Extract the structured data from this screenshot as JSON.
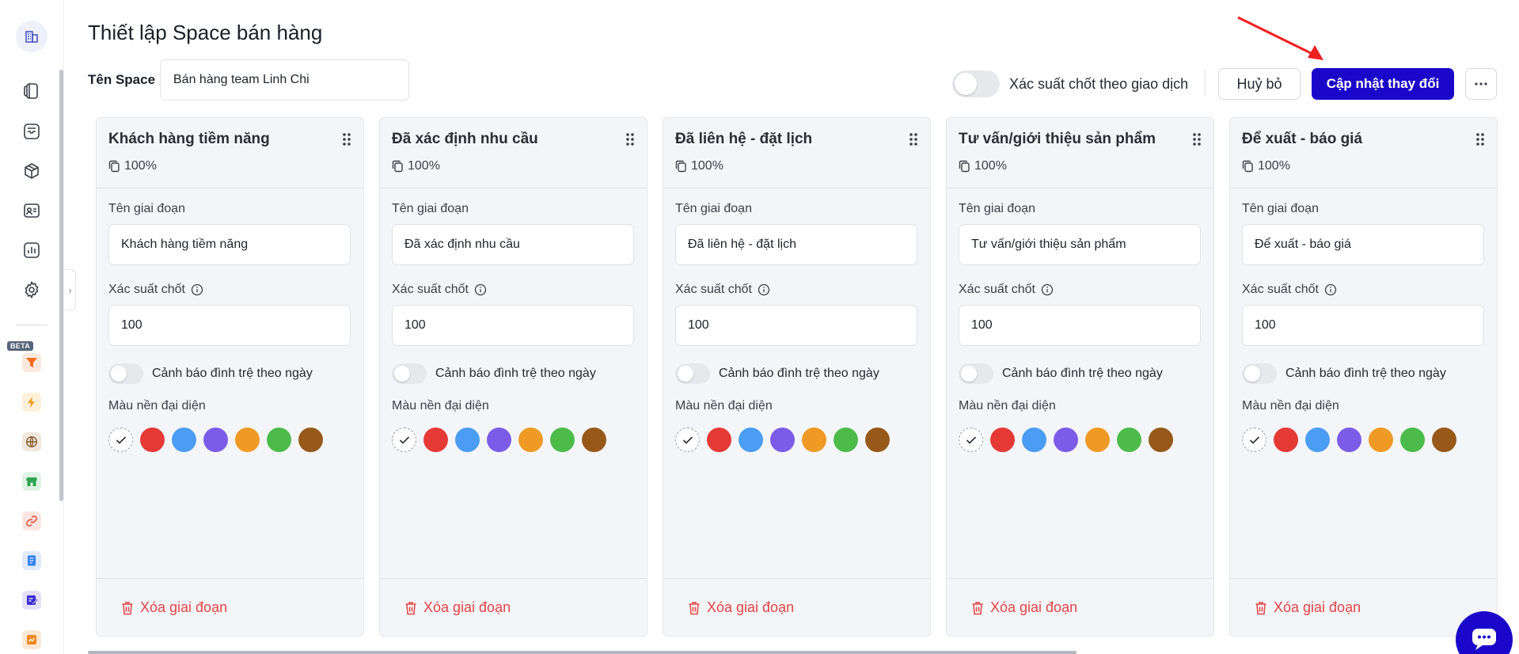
{
  "header": {
    "title": "Thiết lập Space bán hàng",
    "space_label": "Tên Space",
    "space_value": "Bán hàng team Linh Chi",
    "probability_toggle_label": "Xác suất chốt theo giao dịch",
    "cancel_label": "Huỷ bỏ",
    "save_label": "Cập nhật thay đổi",
    "more_label": "···"
  },
  "sidebar": {
    "nav_icons": [
      "book-icon",
      "inbox-icon",
      "box-icon",
      "contact-card-icon",
      "report-chart-icon",
      "settings-gear-icon"
    ],
    "beta_label": "BETA",
    "apps": [
      {
        "icon": "funnel-icon",
        "color": "#f26b1d"
      },
      {
        "icon": "lightning-icon",
        "color": "#f39a1c"
      },
      {
        "icon": "globe-icon",
        "color": "#8a5a2b"
      },
      {
        "icon": "store-icon",
        "color": "#2ea44f"
      },
      {
        "icon": "link-icon",
        "color": "#e5533d"
      },
      {
        "icon": "document-icon",
        "color": "#2f80ed"
      },
      {
        "icon": "edit-note-icon",
        "color": "#3d2bd1"
      },
      {
        "icon": "chart-board-icon",
        "color": "#f08a1c"
      }
    ]
  },
  "stage_common": {
    "name_label": "Tên giai đoạn",
    "probability_label": "Xác suất chốt",
    "stagnation_label": "Cảnh báo đình trệ theo ngày",
    "color_label": "Màu nền đại diện",
    "delete_label": "Xóa giai đoạn",
    "colors": [
      "#e53935",
      "#4a9df2",
      "#7b5ce8",
      "#ef9a24",
      "#4cbb4a",
      "#96591a"
    ]
  },
  "stages": [
    {
      "title": "Khách hàng tiềm năng",
      "percent": "100%",
      "name": "Khách hàng tiềm năng",
      "probability": "100"
    },
    {
      "title": "Đã xác định nhu cầu",
      "percent": "100%",
      "name": "Đã xác định nhu cầu",
      "probability": "100"
    },
    {
      "title": "Đã liên hệ - đặt lịch",
      "percent": "100%",
      "name": "Đã liên hệ - đặt lịch",
      "probability": "100"
    },
    {
      "title": "Tư vấn/giới thiệu sản phẩm",
      "percent": "100%",
      "name": "Tư vấn/giới thiệu sản phẩm",
      "probability": "100"
    },
    {
      "title": "Để xuất - báo giá",
      "percent": "100%",
      "name": "Để xuất - báo giá",
      "probability": "100"
    }
  ]
}
